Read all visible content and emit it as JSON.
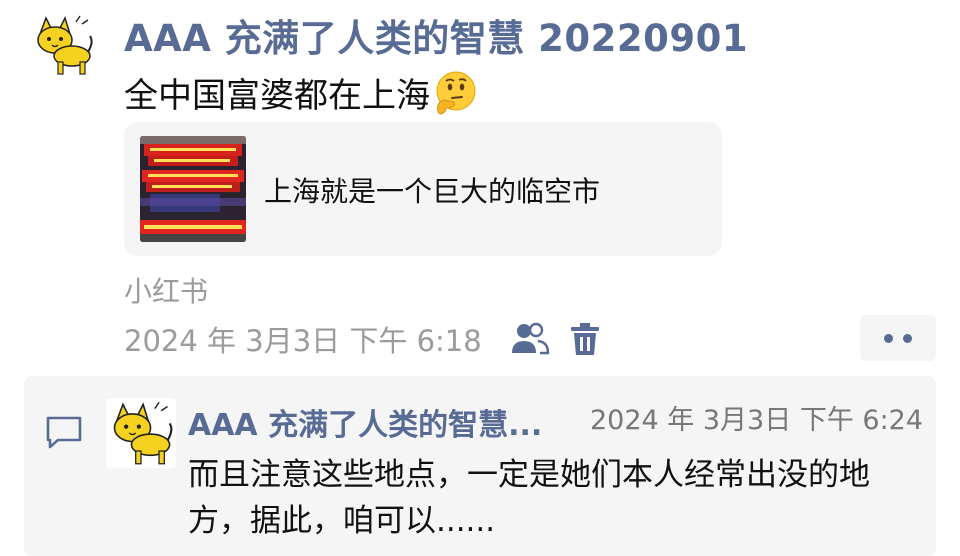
{
  "post": {
    "author_name": "AAA 充满了人类的智慧 20220901",
    "text": "全中国富婆都在上海",
    "link_card": {
      "title": "上海就是一个巨大的临空市"
    },
    "source": "小红书",
    "timestamp": "2024 年 3月3日 下午 6:18"
  },
  "icons": {
    "avatar": "cartoon-cat-avatar",
    "emoji": "thinking-face-emoji",
    "friends": "friends-visibility-icon",
    "trash": "trash-icon",
    "more": "more-dots-icon",
    "comment": "comment-icon"
  },
  "comment": {
    "author_name": "AAA 充满了人类的智慧...",
    "timestamp": "2024 年 3月3日 下午 6:24",
    "text": "而且注意这些地点，一定是她们本人经常出没的地方，据此，咱可以......"
  },
  "colors": {
    "name_blue": "#576b95",
    "muted_gray": "#9b9b9b",
    "card_bg": "#f5f5f6",
    "avatar_yellow": "#f5d21f"
  }
}
